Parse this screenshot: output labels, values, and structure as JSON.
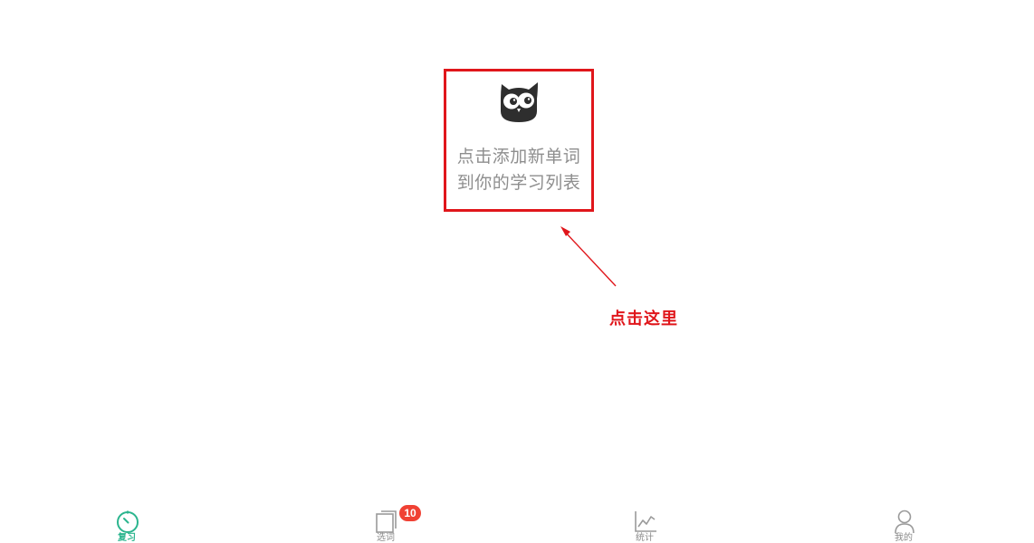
{
  "empty_state": {
    "line1": "点击添加新单词",
    "line2": "到你的学习列表"
  },
  "annotation": {
    "label": "点击这里",
    "color": "#e0161b"
  },
  "tab_bar": {
    "active_color": "#2bb58e",
    "inactive_color": "#8a8a8a",
    "items": [
      {
        "label": "复习",
        "icon": "timer-icon",
        "active": true
      },
      {
        "label": "选词",
        "icon": "word-cards-icon",
        "badge": "10"
      },
      {
        "label": "统计",
        "icon": "line-chart-icon"
      },
      {
        "label": "我的",
        "icon": "person-icon"
      }
    ]
  }
}
